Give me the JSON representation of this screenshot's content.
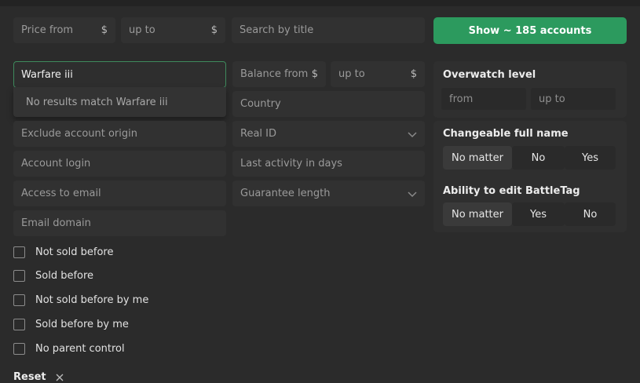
{
  "filters": {
    "price_from": "Price from",
    "price_to": "up to",
    "currency": "$",
    "search_title": "Search by title",
    "show_button": "Show ~ 185 accounts",
    "game_input_value": "Warfare iii",
    "game_dropdown_text": "No results match Warfare iii",
    "balance_from": "Balance from",
    "balance_to": "up to",
    "country": "Country",
    "exclude_origin": "Exclude account origin",
    "real_id": "Real ID",
    "account_login": "Account login",
    "last_activity": "Last activity in days",
    "access_email": "Access to email",
    "guarantee_length": "Guarantee length",
    "email_domain": "Email domain"
  },
  "overwatch": {
    "title": "Overwatch level",
    "from": "from",
    "to": "up to"
  },
  "changeable_name": {
    "title": "Changeable full name",
    "options": [
      "No matter",
      "No",
      "Yes"
    ],
    "selected": "No matter"
  },
  "battletag": {
    "title": "Ability to edit BattleTag",
    "options": [
      "No matter",
      "Yes",
      "No"
    ],
    "selected": "No matter"
  },
  "checkboxes": [
    {
      "label": "Not sold before",
      "checked": false
    },
    {
      "label": "Sold before",
      "checked": false
    },
    {
      "label": "Not sold before by me",
      "checked": false
    },
    {
      "label": "Sold before by me",
      "checked": false
    },
    {
      "label": "No parent control",
      "checked": false
    }
  ],
  "reset_label": "Reset",
  "colors": {
    "background": "#2b2b2b",
    "field": "#313131",
    "accent_green": "#2c9a5e",
    "focus_border": "#3e8a5c"
  }
}
